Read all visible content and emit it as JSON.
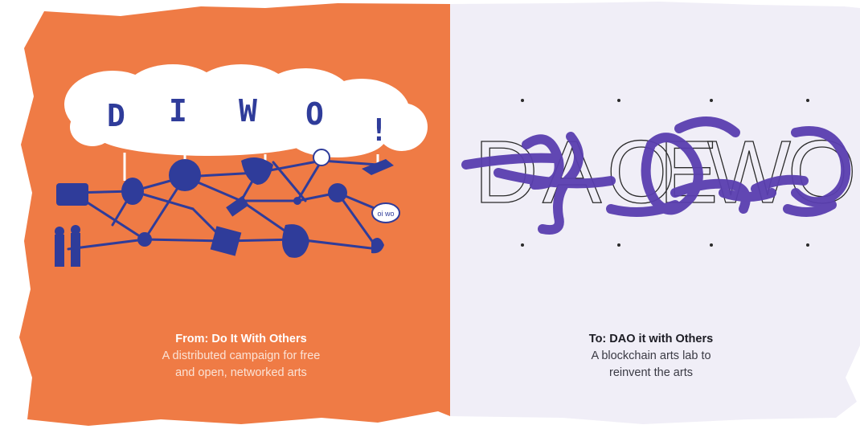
{
  "left_panel": {
    "logo_letters": [
      "D",
      "I",
      "W",
      "O",
      "!"
    ],
    "title": "From: Do It With Others",
    "description_lines": [
      "A distributed campaign for free",
      "and open, networked arts"
    ],
    "bubble_text": "oi wo",
    "color": "#ef7b45"
  },
  "right_panel": {
    "logo_letters": [
      "D",
      "A",
      "O",
      "E",
      "W",
      "O"
    ],
    "title": "To: DAO it with Others",
    "description_lines": [
      "A blockchain arts lab to",
      "reinvent the arts"
    ],
    "color": "#f0eef7",
    "scribble_color": "#5a3fb0"
  }
}
